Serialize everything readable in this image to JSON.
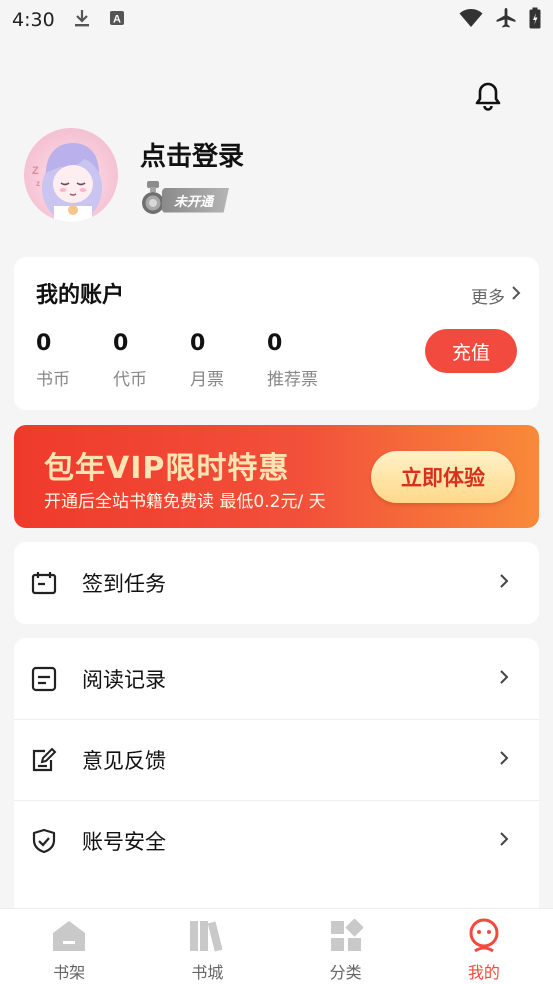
{
  "status_bar": {
    "time": "4:30",
    "icons": [
      "download-icon",
      "a-icon",
      "wifi-icon",
      "airplane-icon",
      "battery-icon"
    ]
  },
  "header": {
    "bell_icon": "bell-icon"
  },
  "profile": {
    "login_text": "点击登录",
    "vip_status": "未开通"
  },
  "account": {
    "title": "我的账户",
    "more_label": "更多",
    "stats": [
      {
        "value": "0",
        "label": "书币"
      },
      {
        "value": "0",
        "label": "代币"
      },
      {
        "value": "0",
        "label": "月票"
      },
      {
        "value": "0",
        "label": "推荐票"
      }
    ],
    "recharge_label": "充值"
  },
  "vip_banner": {
    "title": "包年VIP限时特惠",
    "subtitle": "开通后全站书籍免费读 最低0.2元/ 天",
    "button_label": "立即体验"
  },
  "menu": [
    {
      "label": "签到任务",
      "icon": "calendar-icon"
    },
    {
      "label": "阅读记录",
      "icon": "record-icon"
    },
    {
      "label": "意见反馈",
      "icon": "feedback-icon"
    },
    {
      "label": "账号安全",
      "icon": "shield-icon"
    }
  ],
  "bottom_nav": [
    {
      "label": "书架",
      "icon": "bookshelf-icon",
      "active": false
    },
    {
      "label": "书城",
      "icon": "bookstore-icon",
      "active": false
    },
    {
      "label": "分类",
      "icon": "category-icon",
      "active": false
    },
    {
      "label": "我的",
      "icon": "profile-icon",
      "active": true
    }
  ],
  "colors": {
    "accent": "#f24a3f",
    "banner_gold": "#ffe4b3",
    "background": "#f5f5f5"
  }
}
